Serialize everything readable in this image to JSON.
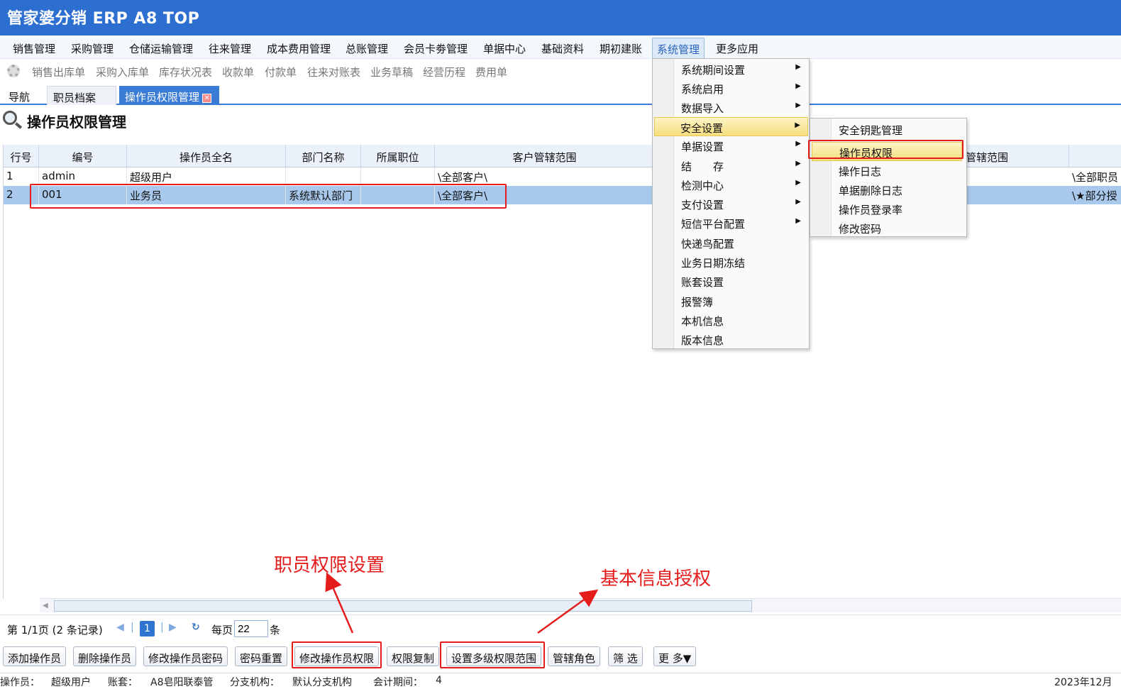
{
  "app": {
    "title": "管家婆分销 ERP A8 TOP"
  },
  "menubar": {
    "items": [
      "销售管理",
      "采购管理",
      "仓储运输管理",
      "往来管理",
      "成本费用管理",
      "总账管理",
      "会员卡劵管理",
      "单据中心",
      "基础资料",
      "期初建账",
      "系统管理",
      "更多应用"
    ],
    "active": "系统管理"
  },
  "quickbar": {
    "items": [
      "销售出库单",
      "采购入库单",
      "库存状况表",
      "收款单",
      "付款单",
      "往来对账表",
      "业务草稿",
      "经营历程",
      "费用单"
    ]
  },
  "tabs": [
    {
      "label": "导航"
    },
    {
      "label": "职员档案"
    },
    {
      "label": "操作员权限管理"
    }
  ],
  "page": {
    "title": "操作员权限管理"
  },
  "table": {
    "columns": [
      "行号",
      "编号",
      "操作员全名",
      "部门名称",
      "所属职位",
      "客户管辖范围",
      "管辖范围"
    ],
    "rows": [
      {
        "no": "1",
        "code": "admin",
        "name": "超级用户",
        "dept": "",
        "position": "",
        "customer_scope": "\\全部客户\\",
        "scope_right": "\\全部职员"
      },
      {
        "no": "2",
        "code": "001",
        "name": "业务员",
        "dept": "系统默认部门",
        "position": "",
        "customer_scope": "\\全部客户\\",
        "scope_right": "\\★部分授"
      }
    ]
  },
  "pager": {
    "page_info": "第 1/1页 (2 条记录)",
    "current_page": "1",
    "per_page_label": "每页",
    "per_page": "22",
    "unit": "条"
  },
  "buttons": [
    "添加操作员",
    "删除操作员",
    "修改操作员密码",
    "密码重置",
    "修改操作员权限",
    "权限复制",
    "设置多级权限范围",
    "管辖角色",
    "筛 选",
    "更 多▼"
  ],
  "statusbar": {
    "operator_label": "操作员：",
    "operator": "超级用户",
    "account_label": "账套：",
    "account": "A8皂阳联泰管",
    "branch_label": "分支机构：",
    "branch": "默认分支机构",
    "period_label": "会计期间：",
    "period": "4",
    "date": "2023年12月"
  },
  "system_menu": {
    "items": [
      "系统期间设置",
      "系统启用",
      "数据导入",
      "安全设置",
      "单据设置",
      "结　　存",
      "检测中心",
      "支付设置",
      "短信平台配置",
      "快递鸟配置",
      "业务日期冻结",
      "账套设置",
      "报警簿",
      "本机信息",
      "版本信息"
    ],
    "has_submenu": [
      true,
      true,
      true,
      true,
      true,
      true,
      true,
      true,
      true,
      false,
      false,
      false,
      false,
      false,
      false
    ],
    "highlighted": "安全设置"
  },
  "security_submenu": {
    "items": [
      "安全钥匙管理",
      "操作员权限",
      "操作日志",
      "单据删除日志",
      "操作员登录率",
      "修改密码"
    ],
    "highlighted": "操作员权限"
  },
  "annotations": {
    "staff_permission": "职员权限设置",
    "basic_info_auth": "基本信息授权"
  },
  "colors": {
    "titlebar": "#2c6fd1",
    "accent": "#3a7bd5",
    "selected_row": "#a9c9ec",
    "annotation": "#e51c1c",
    "menu_highlight": "#f7df7e"
  }
}
